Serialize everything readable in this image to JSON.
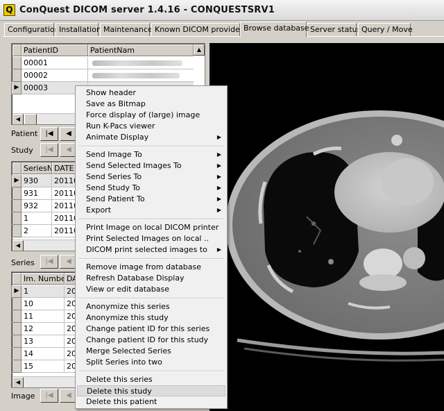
{
  "window": {
    "title": "ConQuest DICOM server 1.4.16 - CONQUESTSRV1",
    "icon_letter": "Q"
  },
  "tabs": [
    {
      "label": "Configuration"
    },
    {
      "label": "Installation"
    },
    {
      "label": "Maintenance"
    },
    {
      "label": "Known DICOM providers"
    },
    {
      "label": "Browse database"
    },
    {
      "label": "Server status"
    },
    {
      "label": "Query / Move"
    }
  ],
  "patients": {
    "columns": [
      "PatientID",
      "PatientNam"
    ],
    "rows": [
      {
        "id": "00001"
      },
      {
        "id": "00002"
      },
      {
        "id": "00003"
      }
    ]
  },
  "series": {
    "columns": [
      "SeriesNu",
      "DATE"
    ],
    "rows": [
      {
        "number": "930",
        "date": "20110"
      },
      {
        "number": "931",
        "date": "20110"
      },
      {
        "number": "932",
        "date": "20110"
      },
      {
        "number": "1",
        "date": "20110"
      },
      {
        "number": "2",
        "date": "20110"
      }
    ]
  },
  "images": {
    "columns": [
      "Im. Number",
      "DA"
    ],
    "rows": [
      {
        "number": "1",
        "date": "20"
      },
      {
        "number": "10",
        "date": "20"
      },
      {
        "number": "11",
        "date": "20"
      },
      {
        "number": "12",
        "date": "20"
      },
      {
        "number": "13",
        "date": "20"
      },
      {
        "number": "14",
        "date": "20"
      },
      {
        "number": "15",
        "date": "20"
      }
    ]
  },
  "nav": {
    "patient": "Patient",
    "study": "Study",
    "series": "Series",
    "image": "Image",
    "first_glyph": "|◀",
    "prev_glyph": "◀"
  },
  "context_menu": {
    "groups": [
      [
        "Show header",
        "Save as Bitmap",
        "Force display of (large) image",
        "Run K-Pacs viewer",
        "Animate Display"
      ],
      [
        "Send Image To",
        "Send Selected Images To",
        "Send Series To",
        "Send Study To",
        "Send Patient To",
        "Export"
      ],
      [
        "Print Image on local DICOM printer",
        "Print Selected Images on local ..",
        "DICOM print selected images to"
      ],
      [
        "Remove image from database",
        "Refresh Database Display",
        "View or edit database"
      ],
      [
        "Anonymize this series",
        "Anonymize this study",
        "Change patient ID for this series",
        "Change patient ID for this study",
        "Merge Selected Series",
        "Split Series into two"
      ],
      [
        "Delete this series",
        "Delete this study",
        "Delete this patient"
      ]
    ],
    "submenu_items": [
      "Animate Display",
      "Send Image To",
      "Send Selected Images To",
      "Send Series To",
      "Send Study To",
      "Send Patient To",
      "Export",
      "DICOM print selected images to"
    ],
    "highlighted": "Delete this study"
  },
  "viewer": {
    "description": "ct-scan-image"
  }
}
